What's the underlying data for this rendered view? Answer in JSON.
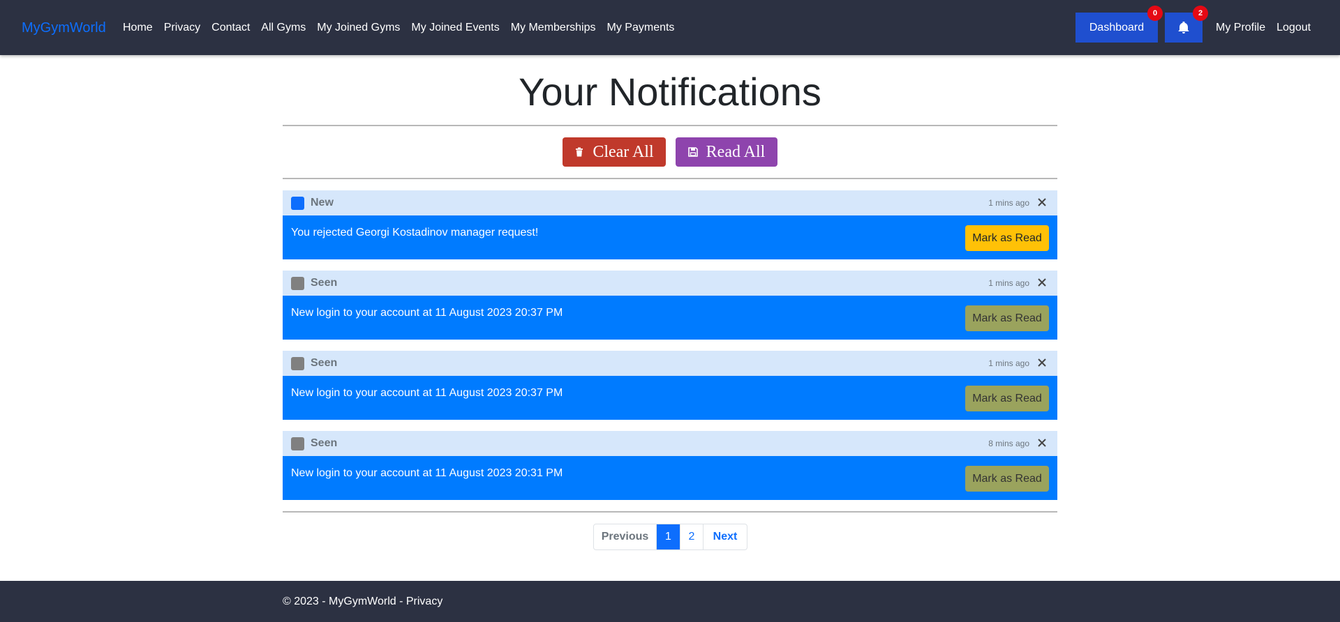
{
  "nav": {
    "brand": "MyGymWorld",
    "links": [
      "Home",
      "Privacy",
      "Contact",
      "All Gyms",
      "My Joined Gyms",
      "My Joined Events",
      "My Memberships",
      "My Payments"
    ],
    "dashboard_label": "Dashboard",
    "dashboard_badge": "0",
    "bell_badge": "2",
    "profile_label": "My Profile",
    "logout_label": "Logout"
  },
  "main": {
    "title": "Your Notifications",
    "clear_all": "Clear All",
    "read_all": "Read All"
  },
  "notifications": [
    {
      "status": "New",
      "time": "1 mins ago",
      "message": "You rejected Georgi Kostadinov manager request!",
      "action": "Mark as Read",
      "square_color": "#0d6efd"
    },
    {
      "status": "Seen",
      "time": "1 mins ago",
      "message": "New login to your account at 11 August 2023 20:37 PM",
      "action": "Mark as Read",
      "square_color": "#808080"
    },
    {
      "status": "Seen",
      "time": "1 mins ago",
      "message": "New login to your account at 11 August 2023 20:37 PM",
      "action": "Mark as Read",
      "square_color": "#808080"
    },
    {
      "status": "Seen",
      "time": "8 mins ago",
      "message": "New login to your account at 11 August 2023 20:31 PM",
      "action": "Mark as Read",
      "square_color": "#808080"
    }
  ],
  "pagination": {
    "previous": "Previous",
    "pages": [
      "1",
      "2"
    ],
    "current": "1",
    "next": "Next"
  },
  "footer": {
    "copyright": "© 2023 - MyGymWorld - ",
    "privacy": "Privacy"
  },
  "colors": {
    "navbar_bg": "#2c3142",
    "brand": "#0d6efd",
    "dashboard_btn": "#1f4fcf",
    "badge": "#e50914",
    "clear_btn": "#c0392b",
    "read_btn": "#8e44ad",
    "notif_head": "#d6e7fb",
    "notif_body": "#007bff",
    "mark_new": "#ffc107",
    "mark_seen": "#9aa35d"
  }
}
